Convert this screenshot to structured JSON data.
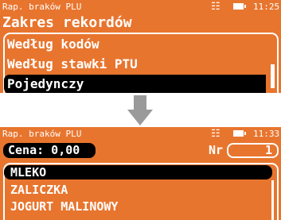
{
  "screen1": {
    "status": {
      "title": "Rap. braków PLU",
      "time": "11:25"
    },
    "heading": "Zakres rekordów",
    "menu": {
      "items": [
        "Według kodów",
        "Według stawki PTU",
        "Pojedynczy"
      ],
      "selected_index": 2
    }
  },
  "screen2": {
    "status": {
      "title": "Rap. braków PLU",
      "time": "11:33"
    },
    "price": "Cena: 0,00",
    "nr_label": "Nr",
    "nr_value": "1",
    "list": {
      "items": [
        "MLEKO",
        "ZALICZKA",
        "JOGURT MALINOWY"
      ],
      "selected_index": 0
    }
  },
  "colors": {
    "screen_bg": "#e8752e",
    "arrow": "#9a9a9a",
    "text": "#ffffff",
    "highlight": "#000000"
  },
  "icons": [
    "network-icon",
    "battery-icon",
    "down-arrow-icon"
  ]
}
